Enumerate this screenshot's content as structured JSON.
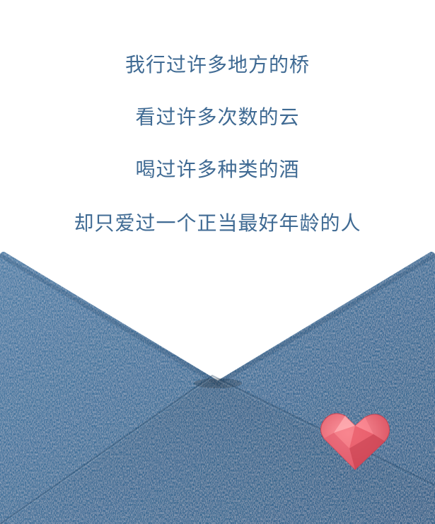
{
  "poem": {
    "lines": [
      "我行过许多地方的桥",
      "看过许多次数的云",
      "喝过许多种类的酒",
      "却只爱过一个正当最好年龄的人"
    ]
  },
  "colors": {
    "text": "#3f6a93",
    "denim_dark": "#2f5d84",
    "denim_mid": "#3f729b",
    "denim_light": "#5a8ab3",
    "heart": "#ef6a78"
  },
  "icons": {
    "heart": "heart-icon",
    "envelope": "envelope-illustration"
  }
}
